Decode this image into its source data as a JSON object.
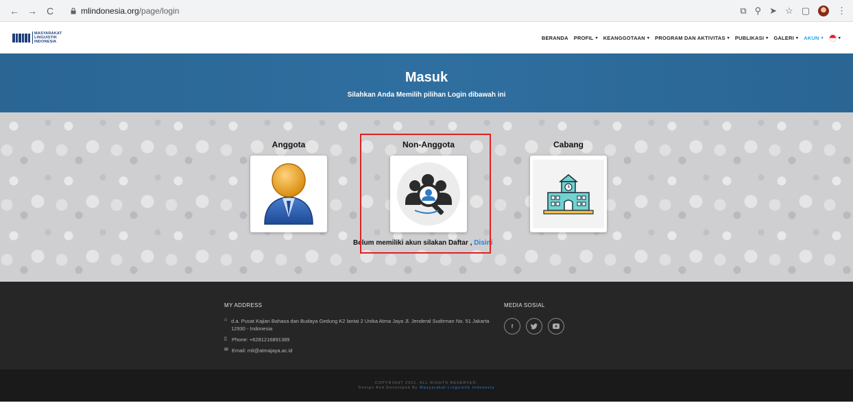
{
  "browser": {
    "url_domain": "mlindonesia.org",
    "url_path": "/page/login"
  },
  "header": {
    "logo_text": [
      "MASYARAKAT",
      "LINGUISTIK",
      "INDONESIA"
    ],
    "nav": [
      {
        "label": "BERANDA",
        "caret": false
      },
      {
        "label": "PROFIL",
        "caret": true
      },
      {
        "label": "KEANGGOTAAN",
        "caret": true
      },
      {
        "label": "PROGRAM DAN AKTIVITAS",
        "caret": true
      },
      {
        "label": "PUBLIKASI",
        "caret": true
      },
      {
        "label": "GALERI",
        "caret": true
      },
      {
        "label": "AKUN",
        "caret": true,
        "active": true
      }
    ]
  },
  "hero": {
    "title": "Masuk",
    "subtitle": "Silahkan Anda Memilih pilihan Login dibawah ini"
  },
  "login_options": {
    "anggota": "Anggota",
    "non_anggota": "Non-Anggota",
    "cabang": "Cabang"
  },
  "register": {
    "text": "Belum memiliki akun silakan Daftar , ",
    "link": "Disini"
  },
  "footer": {
    "address_heading": "MY ADDRESS",
    "address": "d.a. Pusat Kajian Bahasa dan Budaya Gedung K2 lantai 2 Unika Atma Jaya Jl. Jenderal Sudirman No. 51 Jakarta 12930 - Indonesia",
    "phone": "Phone: +6281216891389",
    "email": "Email: mli@atmajaya.ac.id",
    "social_heading": "MEDIA SOSIAL",
    "copyright": "COPYRIGHT 2021. ALL RIGHTS RESERVED.",
    "credit_prefix": "Design And Developed By ",
    "credit_brand": "Masyarakat Linguistik Indonesia"
  },
  "colors": {
    "hero_bg": "#2f6fa0",
    "accent": "#2aa6e0",
    "highlight": "#e02020",
    "footer_bg": "#262626"
  }
}
